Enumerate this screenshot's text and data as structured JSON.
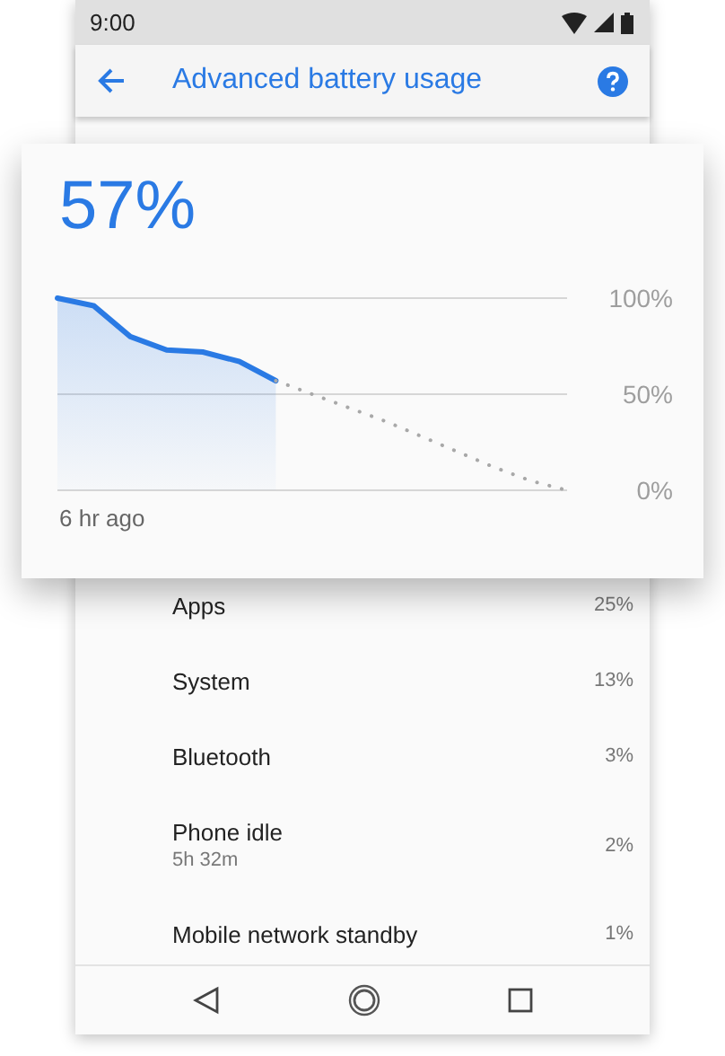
{
  "status_bar": {
    "time": "9:00"
  },
  "app_bar": {
    "title": "Advanced battery usage"
  },
  "battery_card": {
    "level_text": "57%",
    "time_label": "6 hr ago",
    "chart_data": {
      "type": "line",
      "ylim": [
        0,
        100
      ],
      "yticks": [
        {
          "value": 0,
          "label": "0%"
        },
        {
          "value": 50,
          "label": "50%"
        },
        {
          "value": 100,
          "label": "100%"
        }
      ],
      "series": [
        {
          "color": "#2a7ae4",
          "line_style": "solid",
          "values": [
            100,
            96,
            80,
            73,
            72,
            67,
            57,
            null,
            null,
            null,
            null,
            null,
            null,
            null,
            null
          ]
        },
        {
          "color": "#a8a8a8",
          "line_style": "dotted",
          "values": [
            null,
            null,
            null,
            null,
            null,
            null,
            57,
            50,
            43,
            36,
            28,
            20,
            12,
            5,
            0
          ]
        }
      ]
    }
  },
  "usage": [
    {
      "name": "Apps",
      "percent": "25%"
    },
    {
      "name": "System",
      "percent": "13%"
    },
    {
      "name": "Bluetooth",
      "percent": "3%"
    },
    {
      "name": "Phone idle",
      "subtitle": "5h 32m",
      "percent": "2%"
    },
    {
      "name": "Mobile network standby",
      "percent": "1%"
    }
  ]
}
